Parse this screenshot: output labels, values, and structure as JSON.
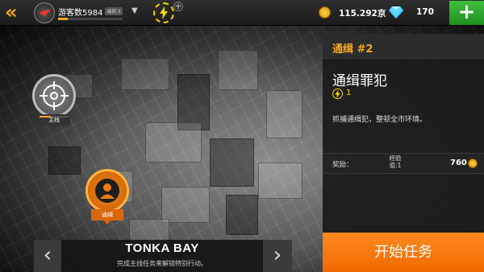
{
  "topbar": {
    "back_icon": "double-chevron-left-icon",
    "player_name": "游客数5984",
    "level_badge": "级别 3",
    "level_progress": 0.15,
    "energy_icon": "lightning-bolt-icon",
    "energy_add": "+",
    "gold_value": "115.292京",
    "diamond_value": "170",
    "add_label": "+"
  },
  "markers": {
    "main": {
      "label": "主线",
      "icon": "crosshair-icon",
      "progress": 0.4
    },
    "wanted": {
      "label": "通缉",
      "icon": "person-icon"
    }
  },
  "region": {
    "name": "TONKA BAY",
    "hint": "完成主线任务来解锁特别行动。",
    "prev": "‹",
    "next": "›"
  },
  "panel": {
    "title": "通缉 #2",
    "mission_name": "通缉罪犯",
    "energy_cost": "1",
    "description": "抓捕通缉犯，整顿全市环境。",
    "reward_label": "奖励：",
    "xp_label": "经验值:1",
    "reward_gold": "760"
  },
  "start_button": "开始任务",
  "colors": {
    "accent": "#f5a623",
    "start_button": "#f47a10",
    "add_button": "#2ea82e",
    "energy": "#f5d800"
  }
}
